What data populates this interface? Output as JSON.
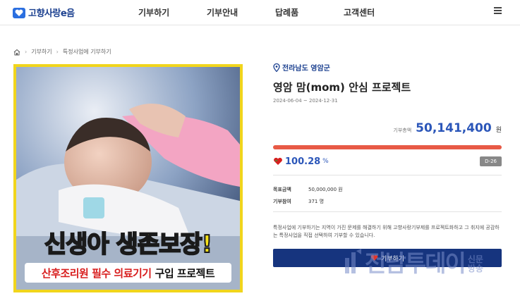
{
  "header": {
    "logo_text": "고향사랑e음",
    "menu": [
      "기부하기",
      "기부안내",
      "답례품",
      "고객센터"
    ]
  },
  "breadcrumb": [
    "기부하기",
    "특정사업에 기부하기"
  ],
  "banner": {
    "headline": "신생아 생존보장!",
    "strip_red": "산후조리원 필수 의료기기",
    "strip_black": "구입 프로젝트"
  },
  "project": {
    "region": "전라남도 영암군",
    "title": "영암 맘(mom) 안심 프로젝트",
    "period": "2024-06-04 ~ 2024-12-31",
    "total_label": "기부총액",
    "total_amount": "50,141,400",
    "total_unit": "원",
    "progress_fraction": 1.0,
    "percent": "100.28",
    "percent_unit": "%",
    "dday": "D-26",
    "target_label": "목표금액",
    "target_value": "50,000,000 원",
    "participants_label": "기부참여",
    "participants_value": "371 명",
    "description": "특정사업에 기부하기는 지역이 가진 문제를 해결하기 위해 고향사랑기부제를 프로젝트화하고 그 취지에 공감하는 특정사업을 직접 선택하여 기부할 수 있습니다.",
    "donate_label": "기부하기"
  },
  "watermark": {
    "text": "전남투데이",
    "sub1": "신문",
    "sub2": "방송"
  },
  "colors": {
    "brand_navy": "#16347e",
    "accent_blue": "#2b56b9",
    "progress_red": "#e85a46",
    "banner_yellow": "#f1d51c"
  }
}
